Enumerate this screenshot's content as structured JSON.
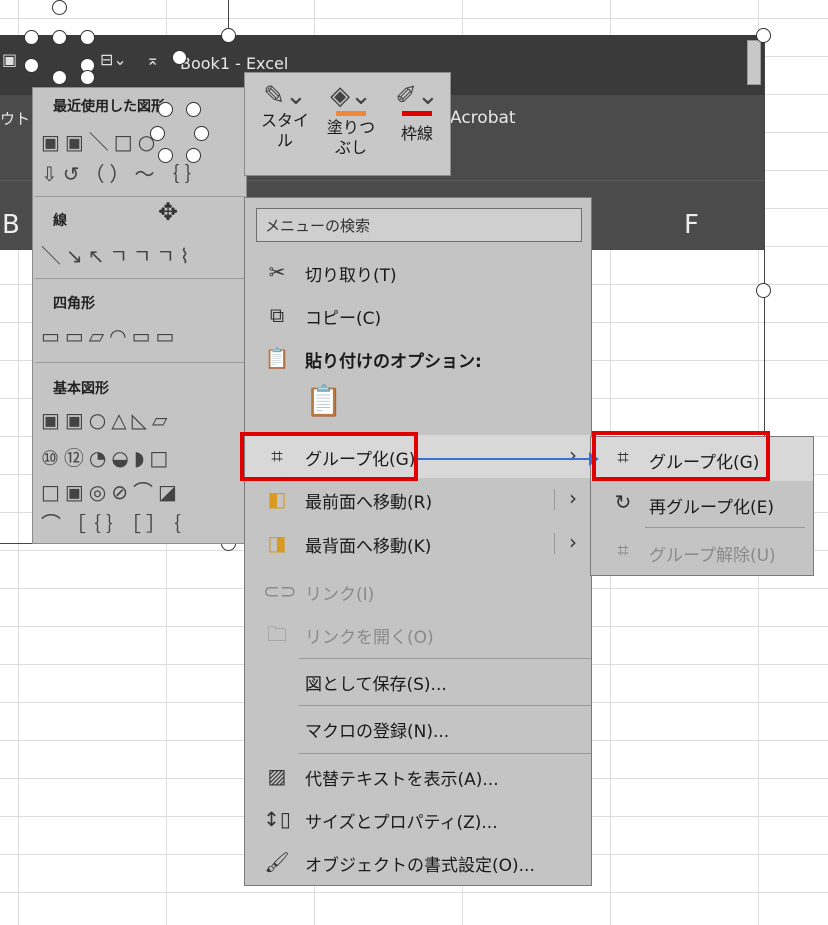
{
  "window": {
    "title": "Book1  -  Excel",
    "ribbon_left": "ウト",
    "ribbon_right": "Acrobat",
    "columns": [
      "B",
      "F"
    ]
  },
  "gallery": {
    "sections": [
      {
        "title": "最近使用した図形",
        "rows": [
          "▣▣＼□○",
          "⇩↺（）〜｛｝"
        ]
      },
      {
        "title": "線",
        "rows": [
          "＼↘↖ㄱㄱㄱ⌇"
        ]
      },
      {
        "title": "四角形",
        "rows": [
          "▭▭▱◠▭▭"
        ]
      },
      {
        "title": "基本図形",
        "rows": [
          "▣▣○△◺▱",
          "⑩⑫◔◒◗□",
          "□▣◎⊘⌒◪",
          "⌒［｛｝［］｛"
        ]
      }
    ]
  },
  "minibar": {
    "buttons": [
      {
        "label1": "スタイ",
        "label2": "ル",
        "icon": "brush-icon",
        "color": ""
      },
      {
        "label1": "塗りつ",
        "label2": "ぶし",
        "icon": "paint-bucket-icon",
        "color": "#f0883a"
      },
      {
        "label1": "枠線",
        "label2": "",
        "icon": "pencil-icon",
        "color": "#e00000"
      }
    ]
  },
  "context_menu": {
    "search_placeholder": "メニューの検索",
    "items": [
      {
        "label": "切り取り(T)",
        "icon": "scissors-icon"
      },
      {
        "label": "コピー(C)",
        "icon": "copy-icon"
      },
      {
        "label": "貼り付けのオプション:",
        "icon": "paste-icon"
      },
      {
        "label": "グループ化(G)",
        "icon": "group-icon"
      },
      {
        "label": "最前面へ移動(R)",
        "icon": "bring-front-icon"
      },
      {
        "label": "最背面へ移動(K)",
        "icon": "send-back-icon"
      },
      {
        "label": "リンク(I)",
        "icon": "link-icon"
      },
      {
        "label": "リンクを開く(O)",
        "icon": "open-link-icon"
      },
      {
        "label": "図として保存(S)...",
        "icon": ""
      },
      {
        "label": "マクロの登録(N)...",
        "icon": ""
      },
      {
        "label": "代替テキストを表示(A)...",
        "icon": "alt-text-icon"
      },
      {
        "label": "サイズとプロパティ(Z)...",
        "icon": "size-icon"
      },
      {
        "label": "オブジェクトの書式設定(O)...",
        "icon": "format-icon"
      }
    ]
  },
  "submenu": {
    "items": [
      {
        "label": "グループ化(G)",
        "icon": "group-icon"
      },
      {
        "label": "再グループ化(E)",
        "icon": "regroup-icon"
      },
      {
        "label": "グループ解除(U)",
        "icon": "ungroup-icon"
      }
    ]
  },
  "colors": {
    "highlight": "#e00000",
    "connector": "#3b6fd8",
    "menu_bg": "#c4c4c4",
    "ribbon_bg": "#4b4b4b"
  }
}
